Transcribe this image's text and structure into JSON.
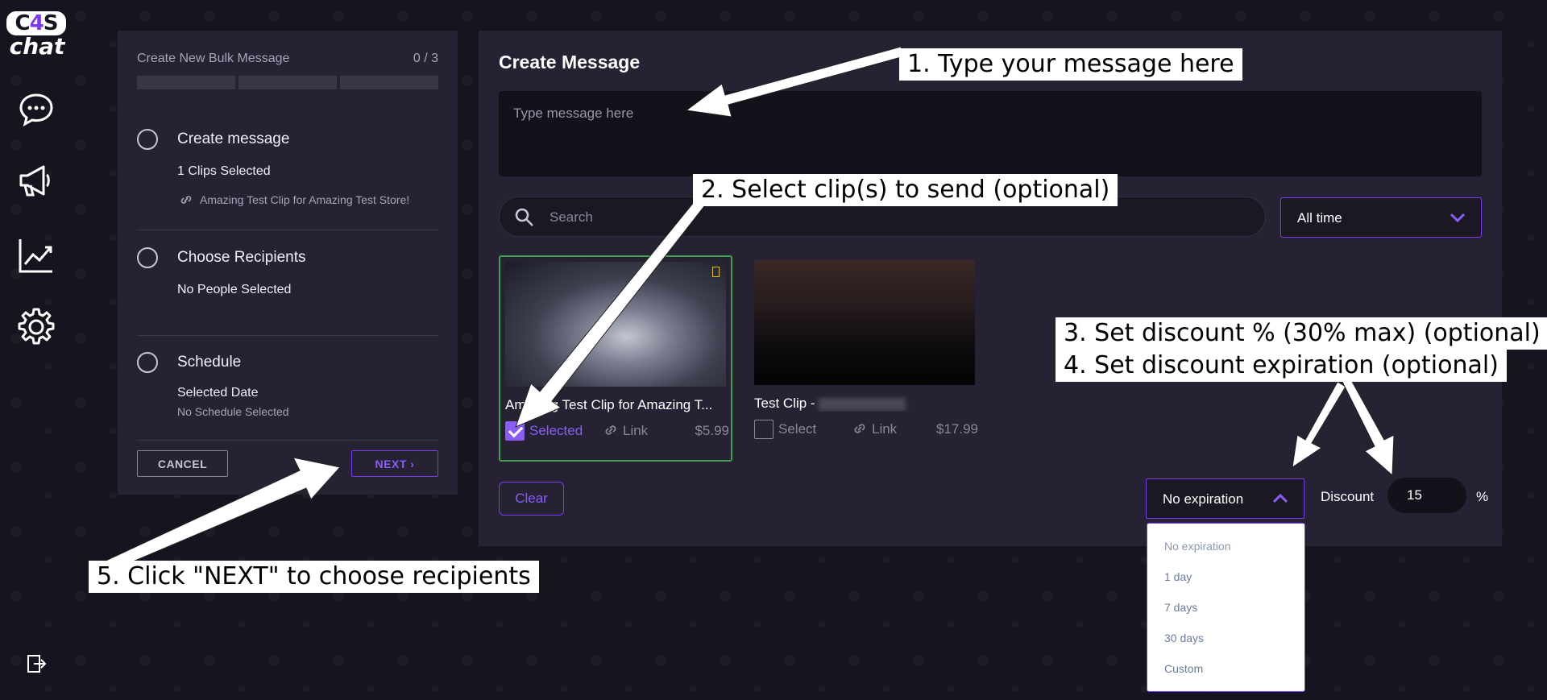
{
  "logo": {
    "top_text_1": "C",
    "top_text_bolt": "4",
    "top_text_2": "S",
    "bottom_text": "chat"
  },
  "nav": [
    {
      "name": "chat-icon"
    },
    {
      "name": "megaphone-icon"
    },
    {
      "name": "chart-icon"
    },
    {
      "name": "gear-icon"
    }
  ],
  "steps_panel": {
    "header_title": "Create New Bulk Message",
    "header_count": "0 / 3",
    "steps": [
      {
        "title": "Create message",
        "sub": "1 Clips Selected",
        "detail": "Amazing Test Clip for Amazing Test Store!"
      },
      {
        "title": "Choose Recipients",
        "sub": "No People Selected"
      },
      {
        "title": "Schedule",
        "sub": "Selected Date",
        "detail": "No Schedule Selected"
      }
    ],
    "cancel_label": "CANCEL",
    "next_label": "NEXT"
  },
  "main": {
    "title": "Create Message",
    "message_placeholder": "Type message here",
    "search_placeholder": "Search",
    "time_filter": "All time",
    "clips": [
      {
        "title": "Amazing Test Clip for Amazing T...",
        "select_label": "Selected",
        "link_label": "Link",
        "price": "$5.99",
        "selected": true
      },
      {
        "title": "Test Clip -",
        "select_label": "Select",
        "link_label": "Link",
        "price": "$17.99",
        "selected": false
      }
    ],
    "clear_label": "Clear",
    "expiration_value": "No expiration",
    "discount_label": "Discount",
    "discount_value": "15",
    "percent_symbol": "%"
  },
  "expiration_options": [
    "No expiration",
    "1 day",
    "7 days",
    "30 days",
    "Custom"
  ],
  "annotations": {
    "a1": "1. Type your message here",
    "a2": "2. Select clip(s) to send (optional)",
    "a3": "3. Set discount % (30% max) (optional)",
    "a4": "4. Set discount expiration (optional)",
    "a5": "5. Click \"NEXT\" to choose recipients"
  },
  "colors": {
    "accent": "#7c3aed",
    "accent_light": "#8b5cf6",
    "panel": "#262233",
    "selected_border": "#3fa34d"
  }
}
